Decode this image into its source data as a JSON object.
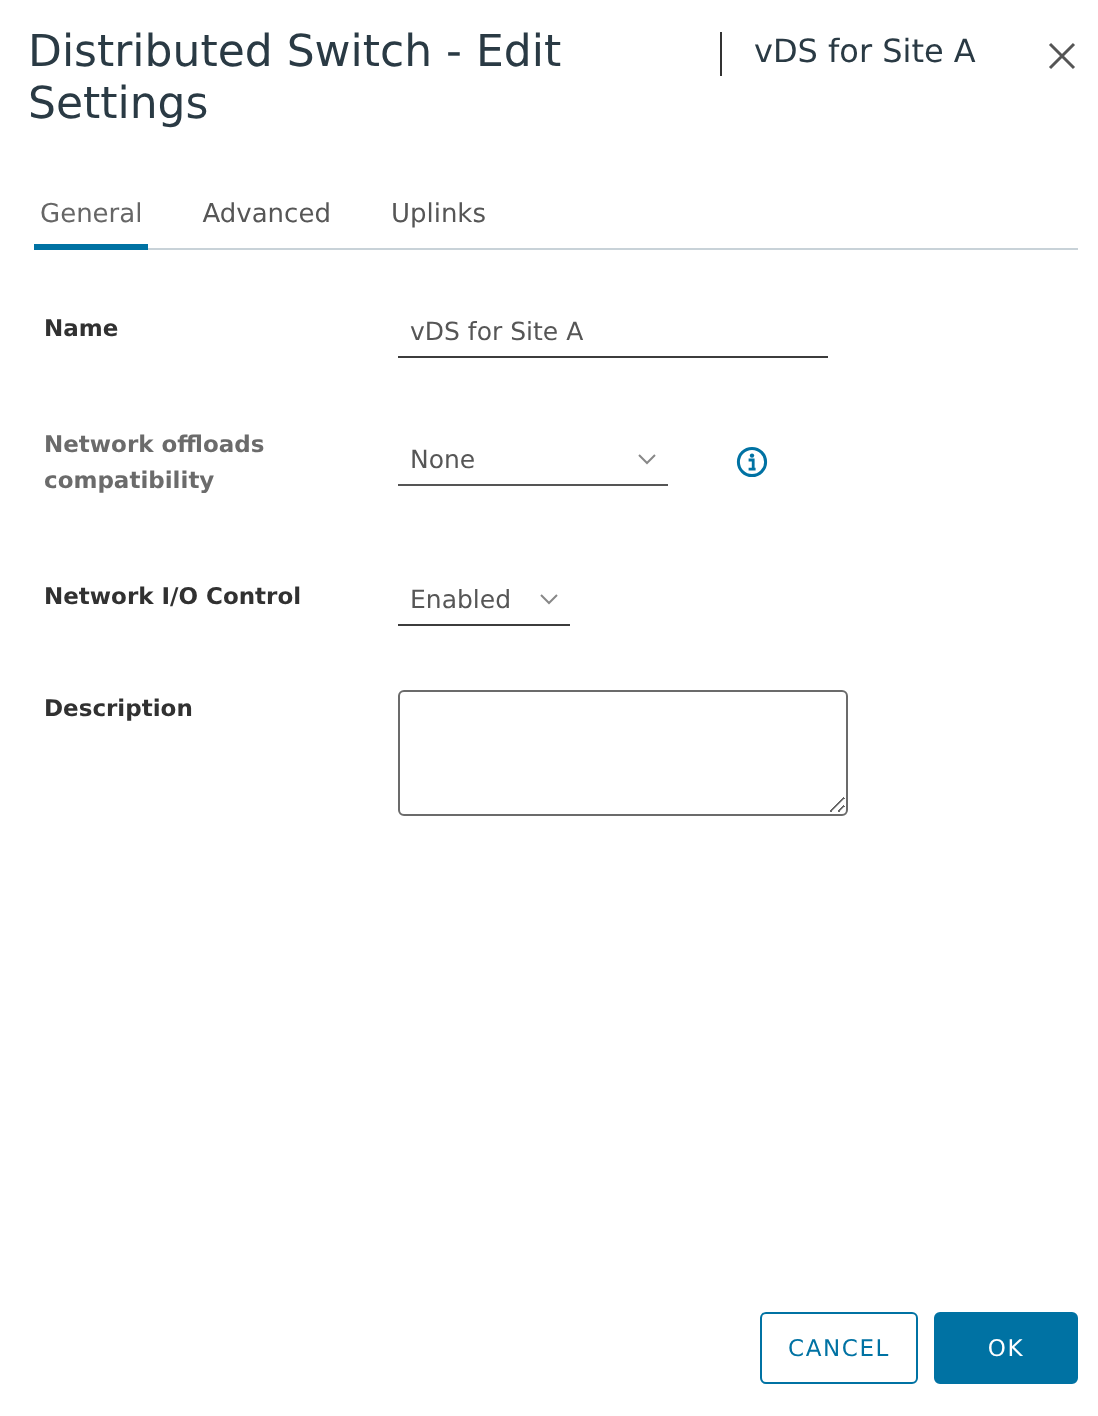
{
  "dialog": {
    "title": "Distributed Switch - Edit Settings",
    "subtitle": "vDS for Site A"
  },
  "tabs": [
    {
      "label": "General",
      "selected": true
    },
    {
      "label": "Advanced",
      "selected": false
    },
    {
      "label": "Uplinks",
      "selected": false
    }
  ],
  "fields": [
    {
      "kind": "text",
      "label": "Name",
      "value": "vDS for Site A",
      "disabled": false
    },
    {
      "kind": "select",
      "label": "Network offloads compatibility",
      "value": "None",
      "disabled": true,
      "info": true
    },
    {
      "kind": "select",
      "label": "Network I/O Control",
      "value": "Enabled",
      "disabled": false,
      "info": false
    },
    {
      "kind": "textarea",
      "label": "Description",
      "disabled": false
    }
  ],
  "buttons": [
    {
      "label": "CANCEL",
      "kind": "secondary"
    },
    {
      "label": "OK",
      "kind": "primary"
    }
  ]
}
